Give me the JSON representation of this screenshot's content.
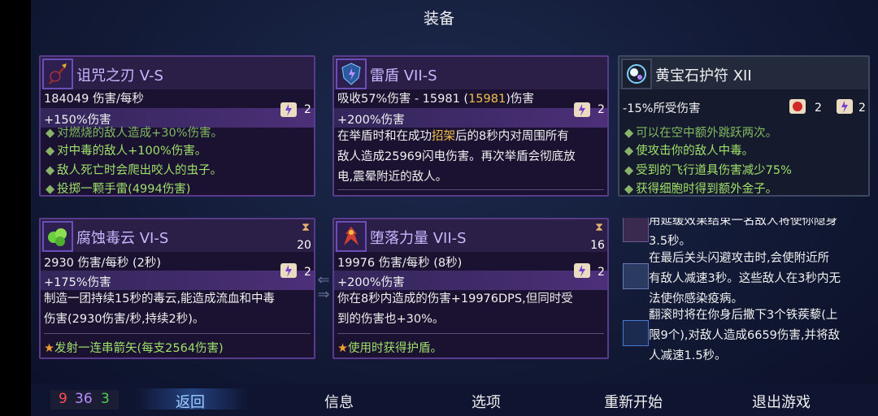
{
  "title": "装备",
  "cards": {
    "curse": {
      "name": "诅咒之刃  V-S",
      "dps": "184049 伤害/每秒",
      "bonus": "+150%伤害",
      "scroll_count": "2",
      "affixes": [
        "对燃烧的敌人造成+30%伤害。",
        "对中毒的敌人+100%伤害。",
        "敌人死亡时会爬出咬人的虫子。",
        "投掷一颗手雷(4994伤害)"
      ]
    },
    "shield": {
      "name": "雷盾  VII-S",
      "stat_pre": "吸收57%伤害 - 15981 (",
      "stat_hl": "15981",
      "stat_post": ")伤害",
      "bonus": "+200%伤害",
      "scroll_count": "2",
      "desc1_pre": "在举盾时和在成功",
      "desc1_hl": "招架",
      "desc1_post": "后的8秒内对周围所有",
      "desc2": "敌人造成25969闪电伤害。再次举盾会彻底放",
      "desc3": "电,震晕附近的敌人。"
    },
    "ruby": {
      "name": "黄宝石护符  XII",
      "stat": "-15%所受伤害",
      "count_a": "2",
      "count_b": "2",
      "affixes": [
        "可以在空中额外跳跃两次。",
        "使攻击你的敌人中毒。",
        "受到的飞行道具伤害减少75%",
        "获得细胞时得到额外金子。"
      ]
    },
    "cloud": {
      "name": "腐蚀毒云  VI-S",
      "cooldown": "20",
      "dps": "2930 伤害/每秒 (2秒)",
      "bonus": "+175%伤害",
      "scroll_count": "2",
      "desc1": "制造一团持续15秒的毒云,能造成流血和中毒",
      "desc2": "伤害(2930伤害/秒,持续2秒)。",
      "star_text": "发射一连串箭矢(每支2564伤害)"
    },
    "power": {
      "name": "堕落力量  VII-S",
      "cooldown": "16",
      "dps": "19976 伤害/每秒 (8秒)",
      "bonus": "+200%伤害",
      "scroll_count": "2",
      "desc1": "你在8秒内造成的伤害+19976DPS,但同时受",
      "desc2": "到的伤害也+30%。",
      "star_text": "使用时获得护盾。"
    },
    "mutations": [
      {
        "lines": [
          "用延缓效果结束一名敌人将使你隐身",
          "3.5秒。"
        ]
      },
      {
        "lines": [
          "在最后关头闪避攻击时,会使附近所",
          "有敌人减速3秒。这些敌人在3秒内无",
          "法使你感染疫病。"
        ]
      },
      {
        "lines": [
          "翻滚时将在你身后撒下3个铁蒺藜(上",
          "限9个),对敌人造成6659伤害,并将敌",
          "人减速1.5秒。"
        ]
      }
    ]
  },
  "stats": {
    "red": "9",
    "purple": "36",
    "green": "3"
  },
  "nav": {
    "back": "返回",
    "info": "信息",
    "options": "选项",
    "restart": "重新开始",
    "quit": "退出游戏"
  },
  "colors": {
    "brutality": "#ff5a5a",
    "tactics": "#b48cff",
    "survival": "#5bd35b",
    "highlight": "#f3c04a"
  }
}
